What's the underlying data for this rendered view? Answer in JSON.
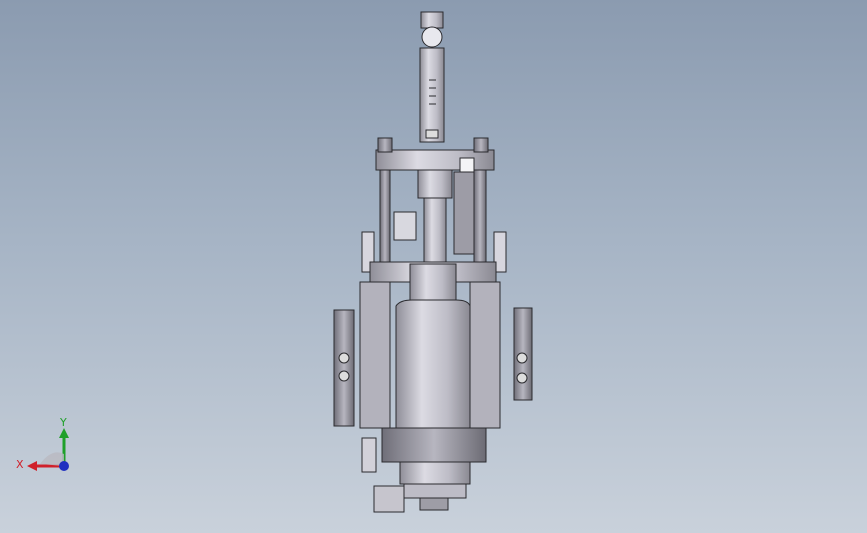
{
  "viewport": {
    "background_top": "#8b9bb0",
    "background_bottom": "#c9d1db"
  },
  "model": {
    "description_icon": "cad-assembly-valve-actuator",
    "body_color": "#c4c2cc",
    "edge_color": "#2a2a2e"
  },
  "triad": {
    "x_label": "X",
    "y_label": "Y",
    "x_color": "#d0202a",
    "y_color": "#1fa02a",
    "z_color": "#2030c0"
  }
}
